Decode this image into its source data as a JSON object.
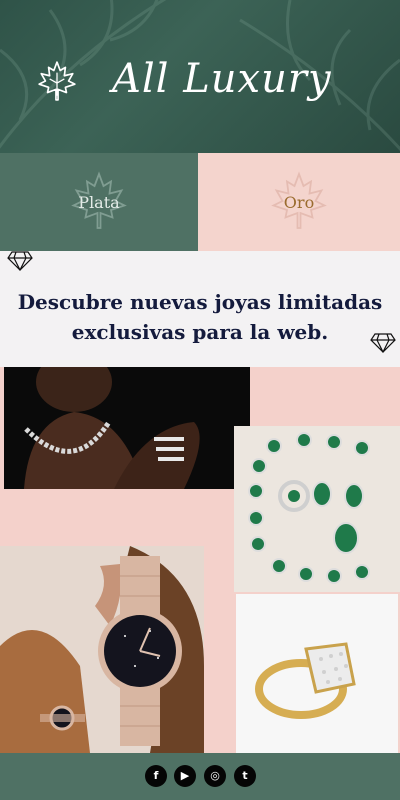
{
  "header": {
    "brand": "All Luxury",
    "logo_icon": "maple-leaf-icon",
    "background_color": "#2f5348"
  },
  "categories": [
    {
      "label": "Plata",
      "color": "#4f7164",
      "text_color": "#e4ece8",
      "icon": "maple-leaf-icon"
    },
    {
      "label": "Oro",
      "color": "#f4d4cd",
      "text_color": "#9a6b2e",
      "icon": "maple-leaf-icon"
    }
  ],
  "promo": {
    "line1": "Descubre nuevas joyas limitadas",
    "line2": "exclusivas para la web.",
    "text_color": "#141b3d",
    "icon": "diamond-icon"
  },
  "gallery": {
    "background_color": "#f4d1cb",
    "photos": [
      {
        "name": "necklace-photo"
      },
      {
        "name": "emerald-jewelry-set-photo"
      },
      {
        "name": "watch-photo"
      },
      {
        "name": "diamond-ring-photo"
      }
    ]
  },
  "footer": {
    "background_color": "#4f7164",
    "social": [
      {
        "icon": "facebook-icon",
        "glyph": "f"
      },
      {
        "icon": "youtube-icon",
        "glyph": "▶"
      },
      {
        "icon": "instagram-icon",
        "glyph": "◎"
      },
      {
        "icon": "twitter-icon",
        "glyph": "t"
      }
    ]
  }
}
